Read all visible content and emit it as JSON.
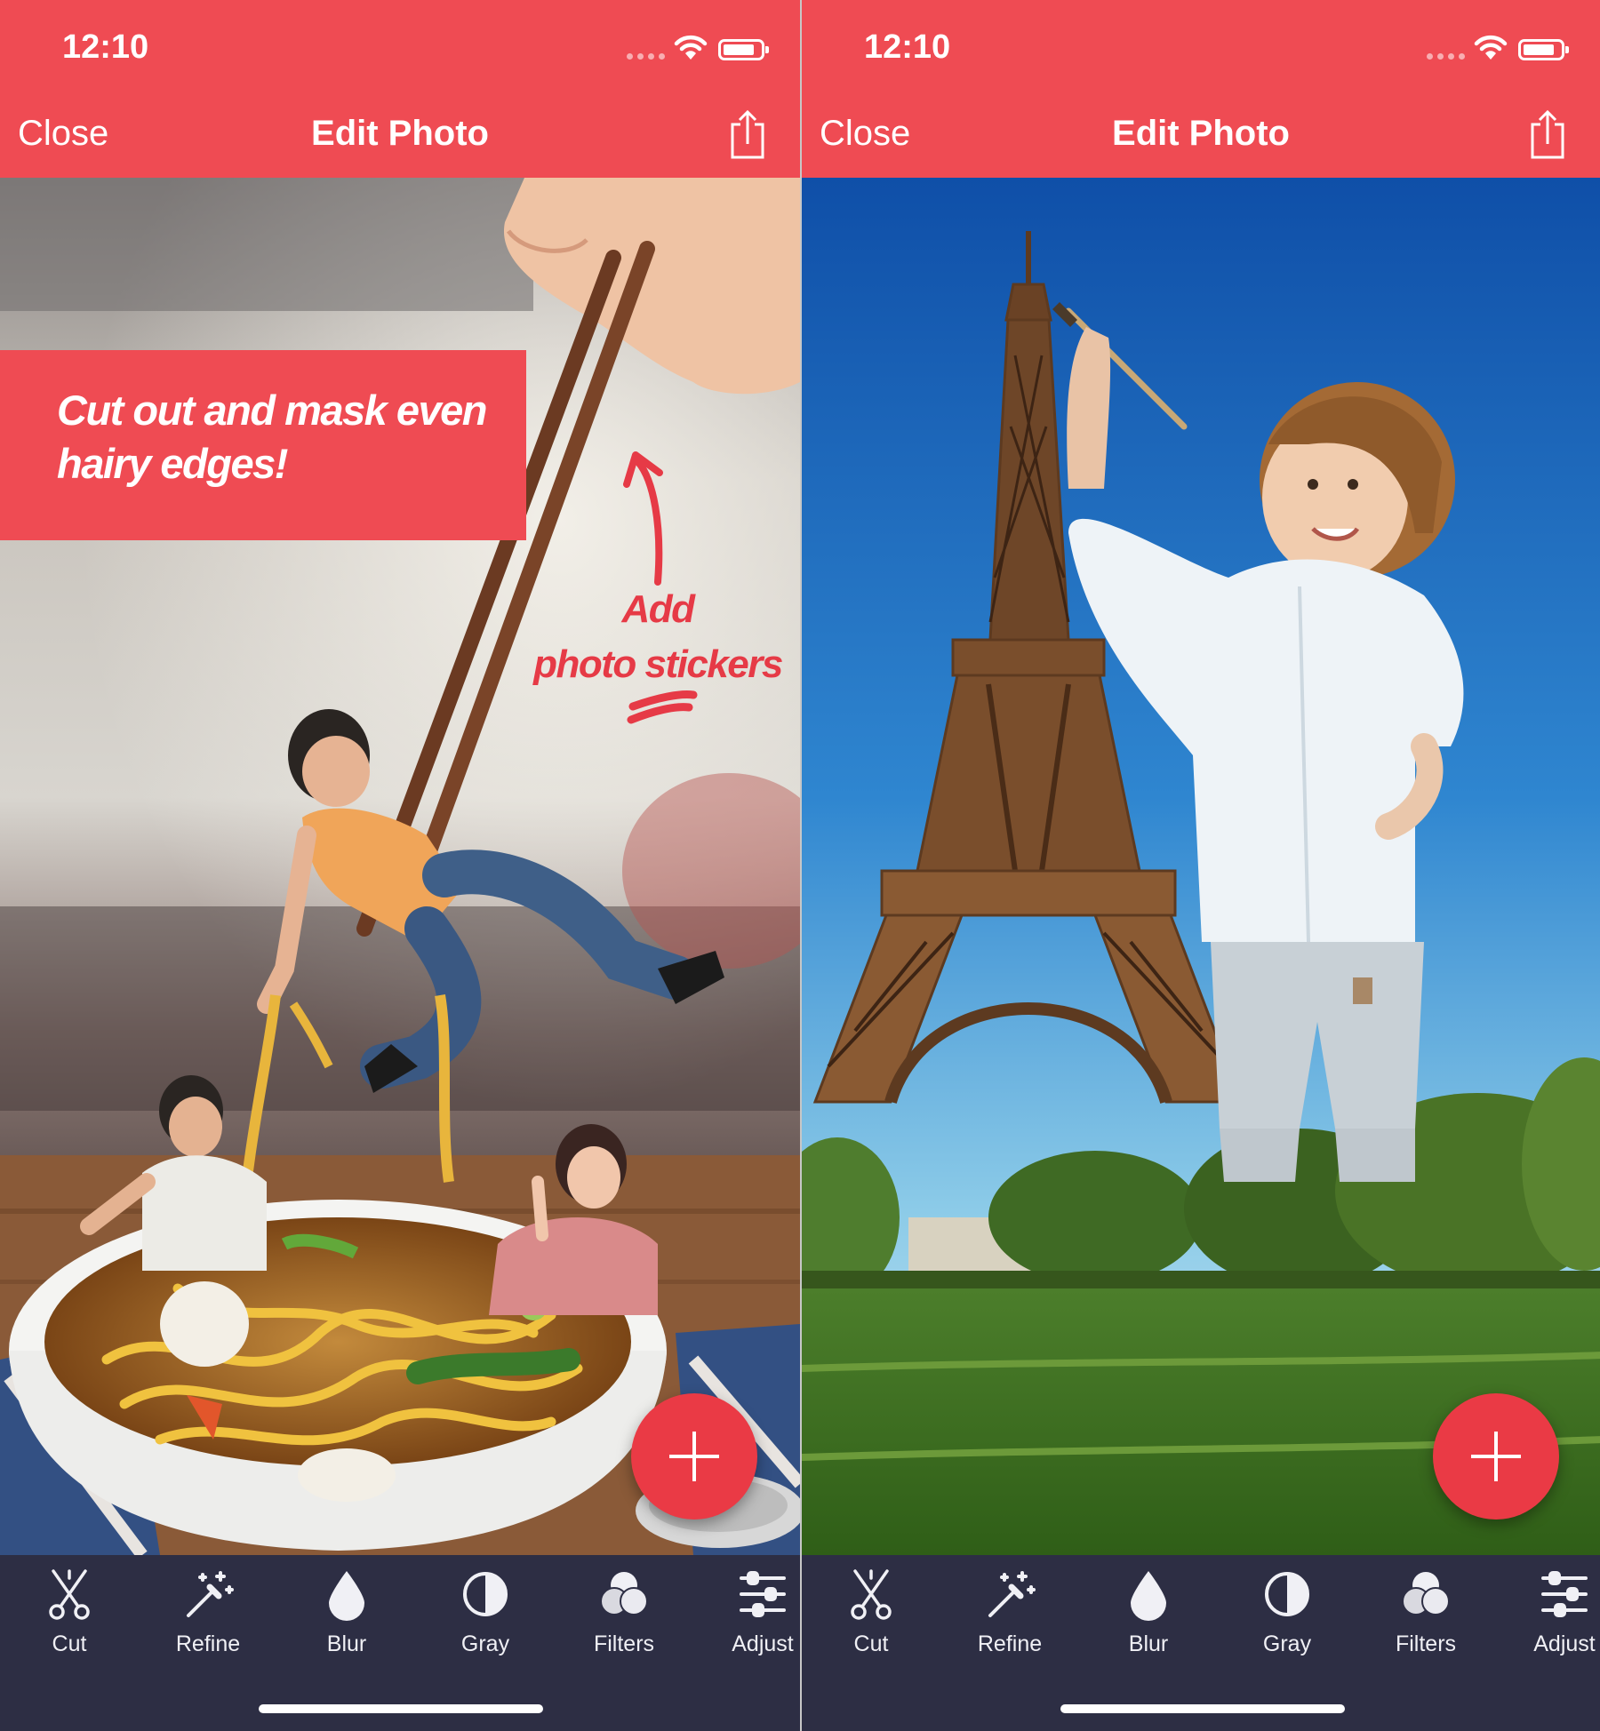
{
  "status_bar": {
    "time": "12:10"
  },
  "nav": {
    "close_label": "Close",
    "title": "Edit Photo"
  },
  "left_screen": {
    "promo_lines": [
      "Cut out and mask even",
      "hairy edges!"
    ],
    "callout_lines": [
      "Add",
      "photo stickers"
    ]
  },
  "toolbar": {
    "tools": [
      {
        "label": "Cut",
        "icon": "scissors-icon"
      },
      {
        "label": "Refine",
        "icon": "magic-wand-icon"
      },
      {
        "label": "Blur",
        "icon": "drop-icon"
      },
      {
        "label": "Gray",
        "icon": "half-circle-icon"
      },
      {
        "label": "Filters",
        "icon": "filters-icon"
      },
      {
        "label": "Adjust",
        "icon": "sliders-icon"
      }
    ]
  },
  "colors": {
    "accent": "#ef4b53",
    "fab": "#ea3a45",
    "toolbar": "#2d2e44"
  }
}
